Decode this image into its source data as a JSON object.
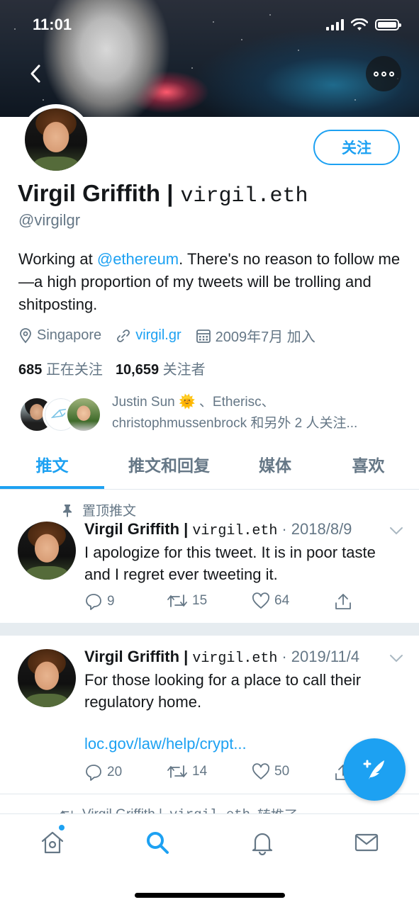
{
  "status_bar": {
    "time": "11:01"
  },
  "profile": {
    "name": "Virgil Griffith |",
    "name_eth": "virgil.eth",
    "handle": "@virgilgr",
    "follow_label": "关注",
    "bio_prefix": "Working at ",
    "bio_mention": "@ethereum",
    "bio_suffix": ". There's no reason to follow me—a high proportion of my tweets will be trolling and shitposting.",
    "location": "Singapore",
    "website": "virgil.gr",
    "joined": "2009年7月 加入",
    "following_count": "685",
    "following_label": "正在关注",
    "followers_count": "10,659",
    "followers_label": "关注者",
    "followed_by_line1": "Justin Sun 🌞 、Etherisc、",
    "followed_by_line2": "christophmussenbrock 和另外 2 人关注..."
  },
  "tabs": [
    "推文",
    "推文和回复",
    "媒体",
    "喜欢"
  ],
  "active_tab": 0,
  "pinned_label": "置顶推文",
  "tweets": [
    {
      "name": "Virgil Griffith |",
      "eth": "virgil.eth",
      "date": "· 2018/8/9",
      "text": "I apologize for this tweet.  It is in poor taste and I regret ever tweeting it.",
      "link": "",
      "replies": "9",
      "retweets": "15",
      "likes": "64"
    },
    {
      "name": "Virgil Griffith |",
      "eth": "virgil.eth",
      "date": "· 2019/11/4",
      "text": "For those looking for a place to call their regulatory home.",
      "link": "loc.gov/law/help/crypt...",
      "replies": "20",
      "retweets": "14",
      "likes": "50"
    }
  ],
  "retweet_peek": {
    "name": "Virgil Griffith |",
    "eth": "virgil.eth",
    "label": "转推了"
  },
  "colors": {
    "accent": "#1da1f2",
    "muted": "#657786",
    "text": "#14171a",
    "divider": "#e6ecf0"
  },
  "icons": {
    "back": "chevron-left-icon",
    "more": "more-icon",
    "location": "location-pin-icon",
    "link": "link-icon",
    "calendar": "calendar-icon",
    "pin": "pin-icon",
    "reply": "reply-icon",
    "retweet": "retweet-icon",
    "like": "heart-icon",
    "share": "share-icon",
    "compose": "compose-icon",
    "home": "home-icon",
    "search": "search-icon",
    "notifications": "bell-icon",
    "messages": "mail-icon"
  }
}
